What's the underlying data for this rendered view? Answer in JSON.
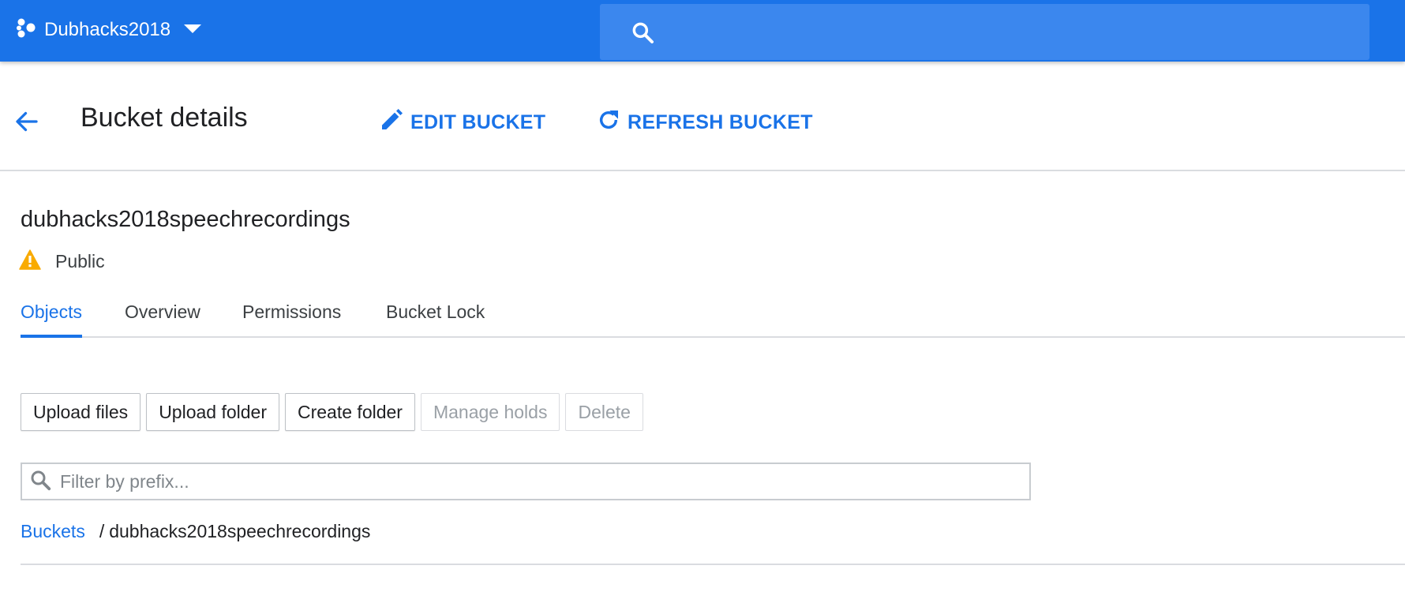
{
  "topbar": {
    "project_name": "Dubhacks2018",
    "project_icon": "hexagon-cluster-icon",
    "search_icon": "search-icon",
    "brand_color": "#1a73e8"
  },
  "header": {
    "back_icon": "arrow-back-icon",
    "title": "Bucket details",
    "edit_label": "EDIT BUCKET",
    "edit_icon": "pencil-icon",
    "refresh_label": "REFRESH BUCKET",
    "refresh_icon": "refresh-icon"
  },
  "bucket": {
    "name": "dubhacks2018speechrecordings",
    "access_label": "Public",
    "access_icon": "warning-icon",
    "warning_color": "#f9ab00"
  },
  "tabs": [
    {
      "label": "Objects",
      "active": true
    },
    {
      "label": "Overview",
      "active": false
    },
    {
      "label": "Permissions",
      "active": false
    },
    {
      "label": "Bucket Lock",
      "active": false
    }
  ],
  "toolbar": {
    "upload_files": "Upload files",
    "upload_folder": "Upload folder",
    "create_folder": "Create folder",
    "manage_holds": "Manage holds",
    "delete": "Delete"
  },
  "filter": {
    "placeholder": "Filter by prefix...",
    "value": ""
  },
  "breadcrumb": {
    "root": "Buckets",
    "separator": "/",
    "current": "dubhacks2018speechrecordings"
  }
}
